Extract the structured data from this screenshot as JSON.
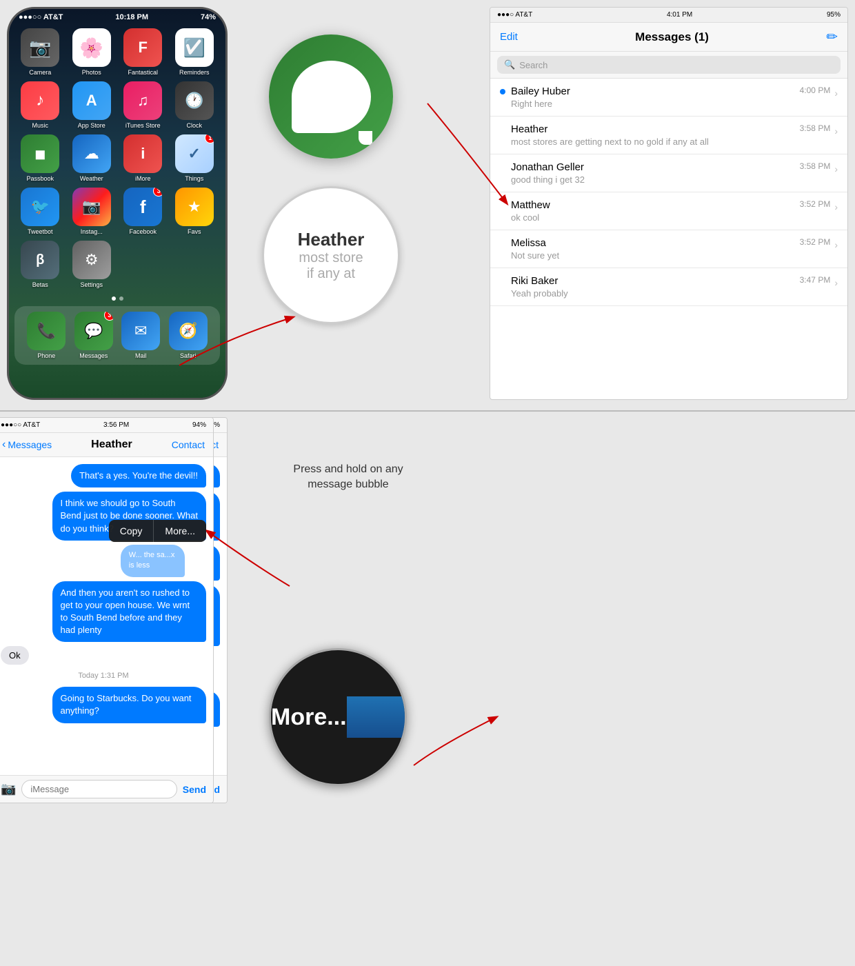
{
  "iphone_home": {
    "status_carrier": "●●●○○ AT&T",
    "status_wifi": "WiFi",
    "status_time": "10:18 PM",
    "status_location": "⬆",
    "status_battery": "74%",
    "apps": [
      {
        "name": "Camera",
        "label": "Camera",
        "icon": "📷",
        "class": "app-clock",
        "badge": null
      },
      {
        "name": "Photos",
        "label": "Photos",
        "icon": "🌸",
        "class": "app-photos",
        "badge": null
      },
      {
        "name": "Fantastical",
        "label": "Fantastical",
        "icon": "📅",
        "class": "app-fantastical",
        "badge": null
      },
      {
        "name": "Reminders",
        "label": "Reminders",
        "icon": "☑️",
        "class": "app-reminders",
        "badge": null
      },
      {
        "name": "Music",
        "label": "Music",
        "icon": "♪",
        "class": "app-music",
        "badge": null
      },
      {
        "name": "App Store",
        "label": "App Store",
        "icon": "A",
        "class": "app-appstore",
        "badge": null
      },
      {
        "name": "iTunes Store",
        "label": "iTunes Store",
        "icon": "♫",
        "class": "app-itunes",
        "badge": null
      },
      {
        "name": "Clock",
        "label": "Clock",
        "icon": "🕐",
        "class": "app-clock",
        "badge": null
      },
      {
        "name": "Passbook",
        "label": "Passbook",
        "icon": "◼",
        "class": "app-passbook",
        "badge": null
      },
      {
        "name": "Weather",
        "label": "Weather",
        "icon": "☁",
        "class": "app-weather",
        "badge": null
      },
      {
        "name": "iMore",
        "label": "iMore",
        "icon": "i",
        "class": "app-imore",
        "badge": null
      },
      {
        "name": "Things",
        "label": "Things",
        "icon": "✓",
        "class": "app-things",
        "badge": "1"
      },
      {
        "name": "Tweetbot",
        "label": "Tweetbot",
        "icon": "🐦",
        "class": "app-tweetbot",
        "badge": null
      },
      {
        "name": "Instagram",
        "label": "Instag...",
        "icon": "📷",
        "class": "app-instagram",
        "badge": null
      },
      {
        "name": "Facebook",
        "label": "Facebook",
        "icon": "f",
        "class": "app-facebook",
        "badge": "3"
      },
      {
        "name": "Favs",
        "label": "Favs",
        "icon": "★",
        "class": "app-favs",
        "badge": null
      },
      {
        "name": "Betas",
        "label": "Betas",
        "icon": "β",
        "class": "app-betas",
        "badge": null
      },
      {
        "name": "Settings",
        "label": "Settings",
        "icon": "⚙",
        "class": "app-settings",
        "badge": null
      }
    ],
    "dock_apps": [
      {
        "name": "Phone",
        "label": "Phone",
        "icon": "📞",
        "class": "app-phone",
        "badge": null
      },
      {
        "name": "Messages",
        "label": "Messages",
        "icon": "💬",
        "class": "app-messages",
        "badge": "3"
      },
      {
        "name": "Mail",
        "label": "Mail",
        "icon": "✉",
        "class": "app-mail",
        "badge": null
      },
      {
        "name": "Safari",
        "label": "Safari",
        "icon": "🧭",
        "class": "app-safari",
        "badge": null
      }
    ]
  },
  "messages_list": {
    "status_carrier": "●●●○ AT&T",
    "status_wifi": "WiFi",
    "status_time": "4:01 PM",
    "status_battery": "95%",
    "title": "Messages (1)",
    "edit_label": "Edit",
    "compose_label": "✏",
    "search_placeholder": "Search",
    "contacts": [
      {
        "name": "Bailey Huber",
        "time": "4:00 PM",
        "preview": "Right here",
        "unread": true
      },
      {
        "name": "Heather",
        "time": "3:58 PM",
        "preview": "most stores are getting next to no gold if any at all",
        "unread": false
      },
      {
        "name": "Jonathan Geller",
        "time": "3:58 PM",
        "preview": "good thing i get 32",
        "unread": false
      },
      {
        "name": "Matthew",
        "time": "3:52 PM",
        "preview": "ok cool",
        "unread": false
      },
      {
        "name": "Melissa",
        "time": "3:52 PM",
        "preview": "Not sure yet",
        "unread": false
      },
      {
        "name": "Riki Baker",
        "time": "3:47 PM",
        "preview": "Yeah probably",
        "unread": false
      }
    ]
  },
  "magnified_heather": {
    "name": "Heather",
    "preview_line1": "most store",
    "preview_line2": "if any at"
  },
  "chat_left": {
    "status_carrier": "●●●○○ AT&T",
    "status_wifi": "WiFi",
    "status_time": "3:56 PM",
    "status_battery": "94%",
    "back_label": "Messages",
    "title": "Heather",
    "contact_label": "Contact",
    "messages": [
      {
        "type": "out",
        "text": "That's a yes. You're the devil!!"
      },
      {
        "type": "out",
        "text": "I think we should go to South Bend just to be done sooner. What do you think?"
      },
      {
        "type": "out",
        "text": "We gain an hour and the sales tax is less"
      },
      {
        "type": "out",
        "text": "And then you aren't so rushed to get to your open house. We wrnt to South Bend before and they had plenty"
      }
    ],
    "ok_message": "Ok",
    "timestamp": "Today 1:31 PM",
    "last_message": "Going to Starbucks. Do you want anything?",
    "input_placeholder": "iMessage",
    "send_label": "Send"
  },
  "annotation": {
    "text": "Press and hold on any\nmessage bubble"
  },
  "chat_right": {
    "status_carrier": "●●●○○ AT&T",
    "status_wifi": "WiFi",
    "status_time": "3:56 PM",
    "status_battery": "94%",
    "back_label": "Messages",
    "title": "Heather",
    "contact_label": "Contact",
    "messages": [
      {
        "type": "out",
        "text": "That's a yes. You're the devil!!"
      },
      {
        "type": "out",
        "text": "I think we should go to South Bend just to be done sooner. What do you think?"
      },
      {
        "type": "out-partial",
        "text": "W...the sa...x is less"
      }
    ],
    "context_copy": "Copy",
    "context_more": "More...",
    "after_context": "And then you aren't so rushed to get to your open house. We wrnt to South Bend before and they had plenty",
    "ok_message": "Ok",
    "timestamp": "Today 1:31 PM",
    "last_message": "Going to Starbucks. Do you want anything?",
    "input_placeholder": "iMessage",
    "send_label": "Send"
  },
  "magnified_more": {
    "text": "More..."
  }
}
